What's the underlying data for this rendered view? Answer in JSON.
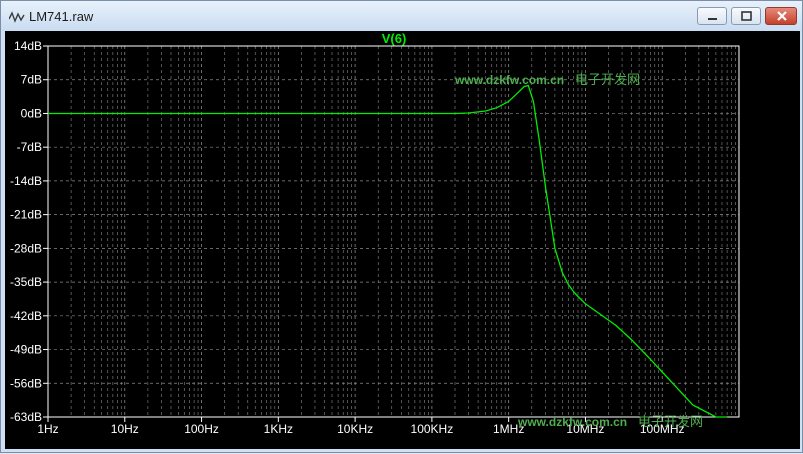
{
  "window": {
    "title": "LM741.raw",
    "buttons": {
      "minimize": "minimize",
      "maximize": "maximize",
      "close": "close"
    }
  },
  "colors": {
    "background": "#000000",
    "axis": "#ffffff",
    "grid": "#8a8a8a",
    "trace": "#00ee00",
    "watermark": "#4fae4f"
  },
  "watermark": {
    "text1": "www.dzkfw.com.cn",
    "text2": "电子开发网"
  },
  "chart_data": {
    "type": "line",
    "title": "V(6)",
    "xscale": "log",
    "xlim": [
      1,
      1000000000
    ],
    "ylim": [
      -63,
      14
    ],
    "xticks": [
      1,
      10,
      100,
      1000,
      10000,
      100000,
      1000000,
      10000000,
      100000000
    ],
    "xtick_labels": [
      "1Hz",
      "10Hz",
      "100Hz",
      "1KHz",
      "10KHz",
      "100KHz",
      "1MHz",
      "10MHz",
      "100MHz"
    ],
    "yticks": [
      14,
      7,
      0,
      -7,
      -14,
      -21,
      -28,
      -35,
      -42,
      -49,
      -56,
      -63
    ],
    "ytick_labels": [
      "14dB",
      "7dB",
      "0dB",
      "-7dB",
      "-14dB",
      "-21dB",
      "-28dB",
      "-35dB",
      "-42dB",
      "-49dB",
      "-56dB",
      "-63dB"
    ],
    "grid": true,
    "series": [
      {
        "name": "V(6)",
        "x": [
          1,
          10,
          100,
          1000,
          10000,
          100000,
          200000,
          300000,
          500000,
          700000,
          1000000,
          1300000,
          1600000,
          1800000,
          2100000,
          2500000,
          3000000,
          4000000,
          5000000,
          6000000,
          7000000,
          8000000,
          10000000,
          15000000,
          25000000,
          40000000,
          70000000,
          120000000,
          250000000,
          500000000,
          700000000
        ],
        "y": [
          0,
          0,
          0,
          0,
          0,
          0,
          0,
          0.1,
          0.5,
          1.2,
          2.5,
          4.2,
          5.6,
          5.8,
          2.5,
          -5.5,
          -15,
          -28,
          -33,
          -35.5,
          -37,
          -38,
          -39.5,
          -41.5,
          -44,
          -47,
          -51,
          -55,
          -60.5,
          -64.5,
          -66
        ]
      }
    ]
  }
}
